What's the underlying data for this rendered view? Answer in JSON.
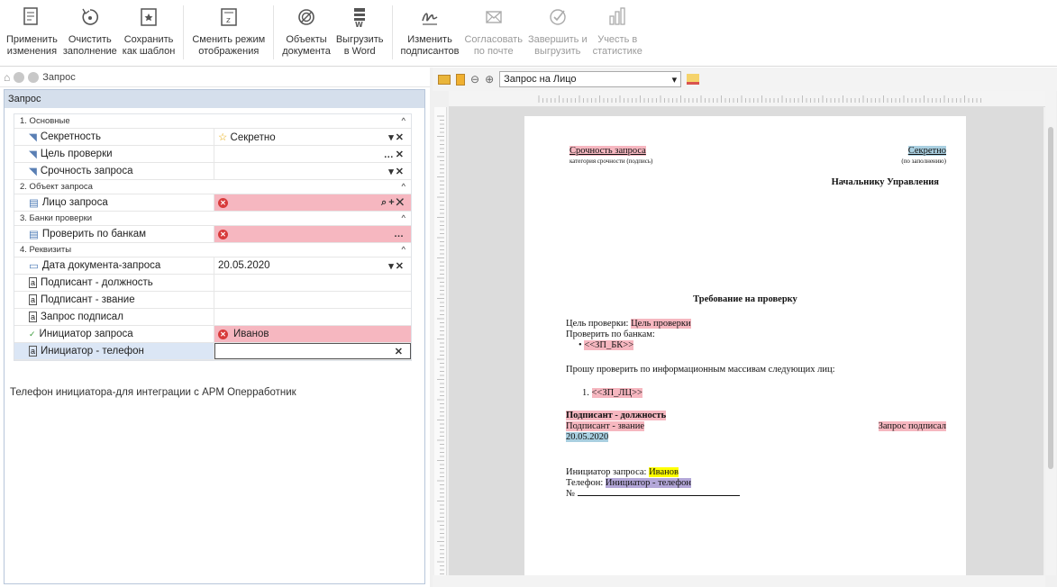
{
  "toolbar": {
    "buttons": [
      {
        "label1": "Применить",
        "label2": "изменения",
        "icon": "apply-icon"
      },
      {
        "label1": "Очистить",
        "label2": "заполнение",
        "icon": "clear-icon"
      },
      {
        "label1": "Сохранить",
        "label2": "как шаблон",
        "icon": "save-template-icon"
      },
      {
        "label1": "Сменить режим",
        "label2": "отображения",
        "icon": "view-mode-icon"
      },
      {
        "label1": "Объекты",
        "label2": "документа",
        "icon": "objects-icon"
      },
      {
        "label1": "Выгрузить",
        "label2": "в Word",
        "icon": "word-export-icon"
      },
      {
        "label1": "Изменить",
        "label2": "подписантов",
        "icon": "signers-icon"
      },
      {
        "label1": "Согласовать",
        "label2": "по почте",
        "icon": "mail-icon"
      },
      {
        "label1": "Завершить и",
        "label2": "выгрузить",
        "icon": "check-circle-icon"
      },
      {
        "label1": "Учесть в",
        "label2": "статистике",
        "icon": "stats-icon"
      }
    ]
  },
  "nav": {
    "title": "Запрос"
  },
  "panel": {
    "title": "Запрос"
  },
  "groups": {
    "g1": "1. Основные",
    "g2": "2. Объект запроса",
    "g3": "3. Банки проверки",
    "g4": "4. Реквизиты"
  },
  "rows": {
    "secrecy": {
      "name": "Секретность",
      "value": "Секретно"
    },
    "goal": {
      "name": "Цель проверки",
      "value": ""
    },
    "urgency": {
      "name": "Срочность запроса",
      "value": ""
    },
    "person": {
      "name": "Лицо запроса",
      "value": ""
    },
    "banks": {
      "name": "Проверить по банкам",
      "value": ""
    },
    "date": {
      "name": "Дата документа-запроса",
      "value": "20.05.2020"
    },
    "signer_pos": {
      "name": "Подписант - должность",
      "value": ""
    },
    "signer_rank": {
      "name": "Подписант - звание",
      "value": ""
    },
    "signed": {
      "name": "Запрос подписал",
      "value": ""
    },
    "initiator": {
      "name": "Инициатор запроса",
      "value": "Иванов"
    },
    "initiator_phone": {
      "name": "Инициатор - телефон",
      "value": ""
    }
  },
  "hint": "Телефон инициатора-для интеграции с АРМ Оперработник",
  "right": {
    "template_select": "Запрос на Лицо"
  },
  "doc": {
    "urgency": "Срочность запроса",
    "urgency_note": "категория срочности (подпись)",
    "secret": "Секретно",
    "secret_note": "(по заполнению)",
    "addressee": "Начальнику Управления",
    "title": "Требование на проверку",
    "goal_label": "Цель проверки:",
    "goal_value": "Цель проверки",
    "banks_label": "Проверить по банкам:",
    "bank_item": "<<ЗП_БК>>",
    "request_text": "Прошу проверить по информационным массивам следующих лиц:",
    "person_item": "<<ЗП_ЛЦ>>",
    "signer_pos": "Подписант - должность",
    "signer_rank": "Подписант - звание",
    "signed": "Запрос подписал",
    "date": "20.05.2020",
    "initiator_label": "Инициатор запроса:",
    "initiator_value": "Иванов",
    "phone_label": "Телефон:",
    "phone_value": "Инициатор - телефон",
    "number_label": "№"
  }
}
